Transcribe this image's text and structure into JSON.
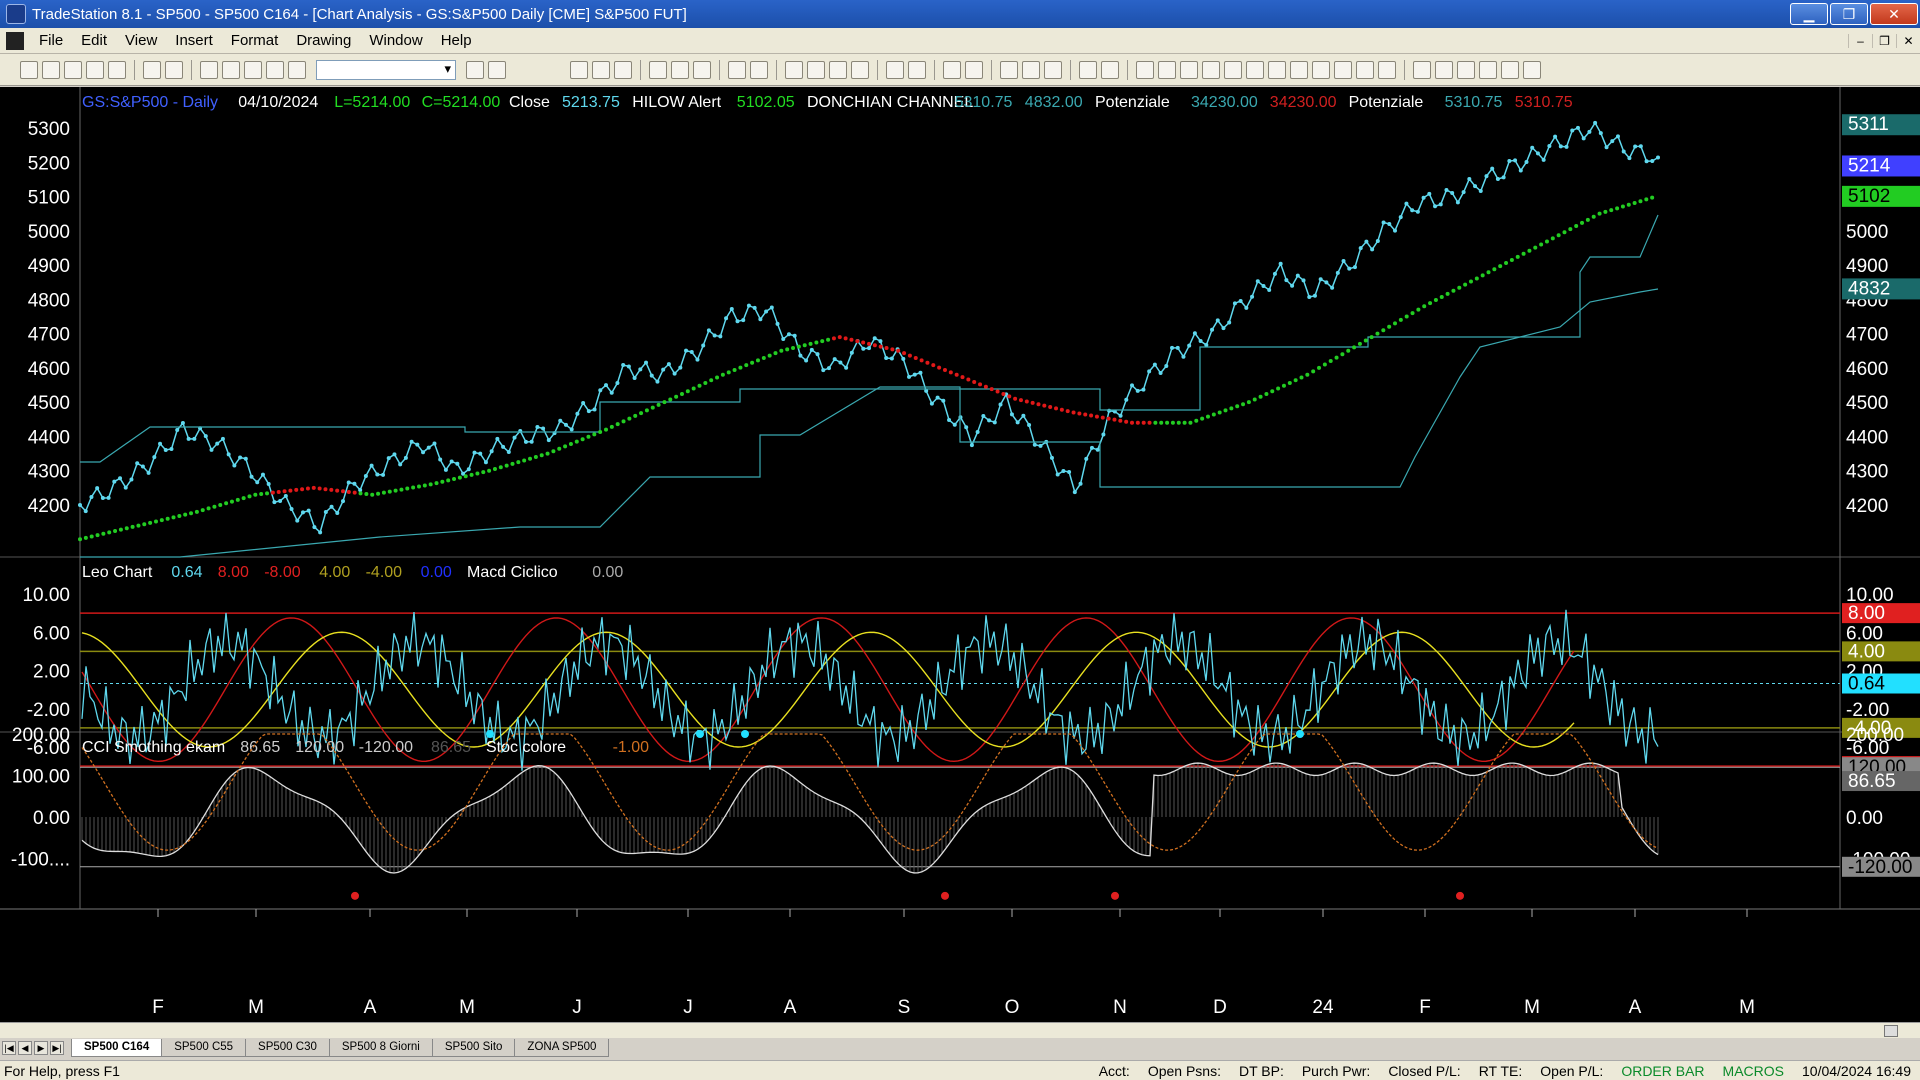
{
  "window": {
    "title": "TradeStation 8.1 - SP500 - SP500 C164 - [Chart Analysis - GS:S&P500  Daily  [CME] S&P500 FUT]"
  },
  "menu": [
    "File",
    "Edit",
    "View",
    "Insert",
    "Format",
    "Drawing",
    "Window",
    "Help"
  ],
  "header": {
    "symbol": "GS:S&P500 - Daily",
    "date": "04/10/2024",
    "low": "L=5214.00",
    "close_val": "C=5214.00",
    "close_label": "Close",
    "close_num": "5213.75",
    "hilow_label": "HILOW Alert",
    "hilow_val": "5102.05",
    "donchian_label": "DONCHIAN CHANNEL",
    "don_up": "5310.75",
    "don_low": "4832.00",
    "pot1": "Potenziale",
    "pot1_a": "34230.00",
    "pot1_b": "34230.00",
    "pot2": "Potenziale",
    "pot2_a": "5310.75",
    "pot2_b": "5310.75"
  },
  "panel2": {
    "name": "Leo Chart",
    "v1": "0.64",
    "v2": "8.00",
    "v3": "-8.00",
    "v4": "4.00",
    "v5": "-4.00",
    "v6": "0.00",
    "name2": "Macd Ciclico",
    "v7": "0.00"
  },
  "panel3": {
    "name": "CCI Smothing ekam",
    "v1": "86.65",
    "v2": "120.00",
    "v3": "-120.00",
    "v4": "86.65",
    "name2": "Stoc colore",
    "v5": "-1.00"
  },
  "axis1": [
    "5300",
    "5200",
    "5100",
    "5000",
    "4900",
    "4800",
    "4700",
    "4600",
    "4500",
    "4400",
    "4300",
    "4200"
  ],
  "axis2": [
    "10.00",
    "6.00",
    "2.00",
    "-2.00",
    "-6.00"
  ],
  "axis3": [
    "200.00",
    "100.00",
    "0.00",
    "-100...."
  ],
  "badges1": {
    "high": "5311",
    "price": "5214",
    "hilow": "5102",
    "low": "4832"
  },
  "badges2": {
    "up": "8.00",
    "up2": "4.00",
    "zero": "0.64",
    "dn2": "-4.00",
    "dn": "-8.00",
    "ten": "10.00",
    "six": "6.00",
    "two": "2.00",
    "m2": "-2.00",
    "m6": "-6.00"
  },
  "badges3": {
    "top": "200.00",
    "hi": "120.00",
    "val": "86.65",
    "zero": "0.00",
    "lo": "-120.00",
    "lo_under": "-100.00"
  },
  "months": [
    "F",
    "M",
    "A",
    "M",
    "J",
    "J",
    "A",
    "S",
    "O",
    "N",
    "D",
    "24",
    "F",
    "M",
    "A",
    "M"
  ],
  "tabs": [
    "SP500 C164",
    "SP500 C55",
    "SP500 C30",
    "SP500 8 Giorni",
    "SP500 Sito",
    "ZONA SP500"
  ],
  "status": {
    "help": "For Help, press F1",
    "acct": "Acct:",
    "psns": "Open Psns:",
    "dtbp": "DT BP:",
    "purch": "Purch Pwr:",
    "closed": "Closed P/L:",
    "rtte": "RT TE:",
    "openpl": "Open P/L:",
    "orderbar": "ORDER BAR",
    "macros": "MACROS",
    "datetime": "10/04/2024 16:49"
  },
  "colors": {
    "bg": "#000000",
    "price": "#5fd8ee",
    "up": "#22cc22",
    "down": "#e01818",
    "channel": "#3aa8b0",
    "yellow": "#e8e020",
    "red": "#d01818",
    "olive": "#8a8a10"
  },
  "chart_data": {
    "type": "line",
    "title": "GS:S&P500 - Daily",
    "series": [
      {
        "name": "Close",
        "values": [
          4200,
          4250,
          4320,
          4420,
          4380,
          4300,
          4200,
          4140,
          4260,
          4320,
          4380,
          4300,
          4360,
          4400,
          4420,
          4500,
          4600,
          4580,
          4650,
          4750,
          4770,
          4650,
          4600,
          4680,
          4620,
          4500,
          4400,
          4500,
          4380,
          4250,
          4450,
          4560,
          4650,
          4700,
          4800,
          4880,
          4820,
          4900,
          5000,
          5080,
          5100,
          5150,
          5200,
          5250,
          5300,
          5240,
          5214
        ]
      },
      {
        "name": "HILOW Alert",
        "values": [
          4100,
          4140,
          4180,
          4230,
          4250,
          4230,
          4260,
          4300,
          4350,
          4420,
          4500,
          4580,
          4650,
          4690,
          4650,
          4580,
          4510,
          4470,
          4440,
          4440,
          4500,
          4580,
          4680,
          4780,
          4870,
          4960,
          5050,
          5102
        ]
      }
    ],
    "ylim": [
      4100,
      5350
    ]
  }
}
